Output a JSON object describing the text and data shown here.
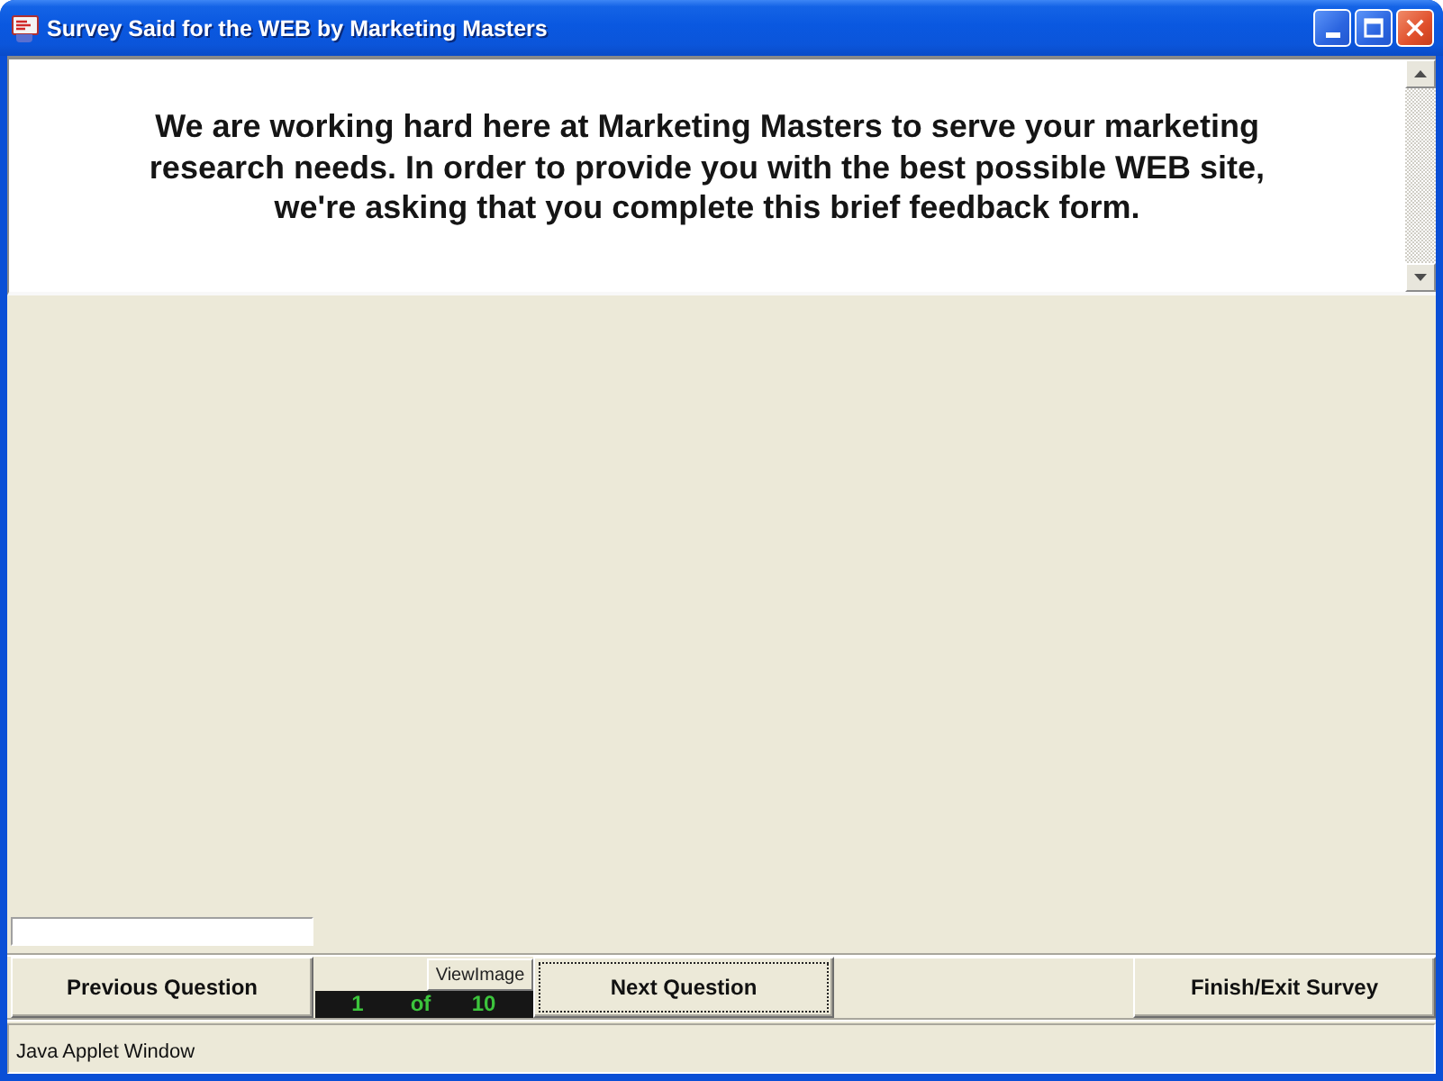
{
  "window": {
    "title": "Survey Said for the WEB by Marketing Masters"
  },
  "intro": {
    "text": "We are working hard here at Marketing Masters to serve your marketing\nresearch needs. In order to provide you with the best possible WEB site,\nwe're asking that you complete this brief feedback form."
  },
  "controls": {
    "previous": {
      "label": "Previous Question",
      "focused": false
    },
    "counter": {
      "view_image_label": "ViewImage",
      "current": "1",
      "of": "of",
      "total": "10"
    },
    "next": {
      "label": "Next Question",
      "focused": true
    },
    "finish": {
      "label": "Finish/Exit Survey",
      "focused": false
    }
  },
  "status_bar": {
    "text": "Java Applet Window"
  }
}
